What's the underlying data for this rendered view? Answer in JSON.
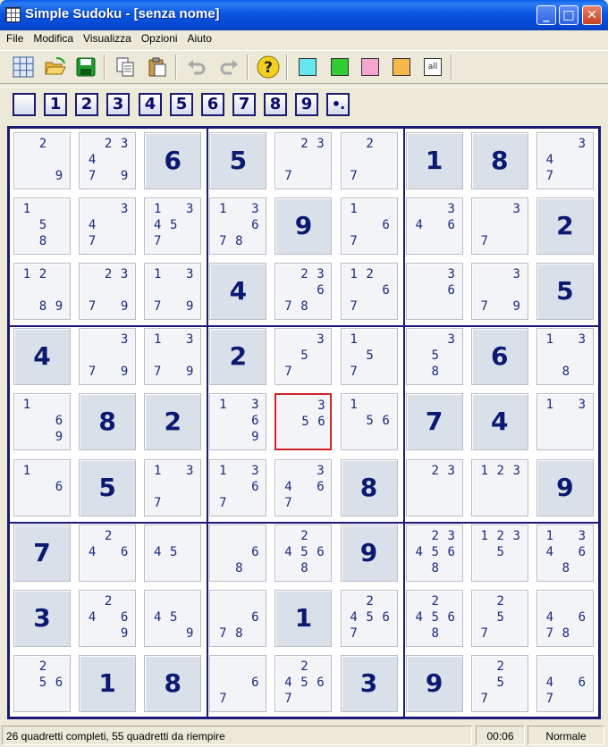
{
  "window": {
    "title": "Simple Sudoku - [senza nome]",
    "minimize_glyph": "_",
    "maximize_glyph": "□",
    "close_glyph": "✕"
  },
  "menu": [
    "File",
    "Modifica",
    "Visualizza",
    "Opzioni",
    "Aiuto"
  ],
  "toolbar": {
    "icons": [
      "grid-icon",
      "open-folder-icon",
      "save-disk-icon",
      "copy-icon",
      "paste-icon",
      "undo-icon",
      "redo-icon",
      "help-icon",
      "color-cyan-icon",
      "color-green-icon",
      "color-pink-icon",
      "color-orange-icon",
      "show-all-icon"
    ],
    "help_glyph": "?",
    "all_label": "all",
    "highlight_colors": [
      "#66e6ee",
      "#33cc33",
      "#f4a6d0",
      "#f6b84a"
    ]
  },
  "number_buttons": [
    "",
    "1",
    "2",
    "3",
    "4",
    "5",
    "6",
    "7",
    "8",
    "9",
    "•."
  ],
  "grid": [
    [
      "c:2,9",
      "c:2,3,4,7,9",
      "6",
      "5",
      "c:2,3,7",
      "c:2,7",
      "1",
      "8",
      "c:3,4,7"
    ],
    [
      "c:1,5,8",
      "c:3,4,7",
      "c:1,3,4,5,7",
      "c:1,3,6,7,8",
      "9",
      "c:1,6,7",
      "c:3,4,6",
      "c:3,7",
      "2"
    ],
    [
      "c:1,2,8,9",
      "c:2,3,7,9",
      "c:1,3,7,9",
      "4",
      "c:2,3,6,7,8",
      "c:1,2,6,7",
      "c:3,6",
      "c:3,7,9",
      "5"
    ],
    [
      "4",
      "c:3,7,9",
      "c:1,3,7,9",
      "2",
      "c:3,5,7",
      "c:1,5,7",
      "c:3,5,8",
      "6",
      "c:1,3,8"
    ],
    [
      "c:1,6,9",
      "8",
      "2",
      "c:1,3,6,9",
      "c:3,5,6",
      "c:1,5,6",
      "7",
      "4",
      "c:1,3"
    ],
    [
      "c:1,6",
      "5",
      "c:1,3,7",
      "c:1,3,6,7",
      "c:3,4,6,7",
      "8",
      "c:2,3",
      "c:1,2,3",
      "9"
    ],
    [
      "7",
      "c:2,4,6",
      "c:4,5",
      "c:6,8",
      "c:2,4,5,6,8",
      "9",
      "c:2,3,4,5,6,8",
      "c:1,2,3,5",
      "c:1,3,4,6,8"
    ],
    [
      "3",
      "c:2,4,6,9",
      "c:4,5,9",
      "c:6,7,8",
      "1",
      "c:2,4,5,6,7",
      "c:2,4,5,6,8",
      "c:2,5,7",
      "c:4,6,7,8"
    ],
    [
      "c:2,5,6",
      "1",
      "8",
      "c:6,7",
      "c:2,4,5,6,7",
      "3",
      "9",
      "c:2,5,7",
      "c:4,6,7"
    ]
  ],
  "selected_cell": [
    4,
    4
  ],
  "status": {
    "message": "26 quadretti completi, 55 quadretti da riempire",
    "time": "00:06",
    "level": "Normale"
  }
}
